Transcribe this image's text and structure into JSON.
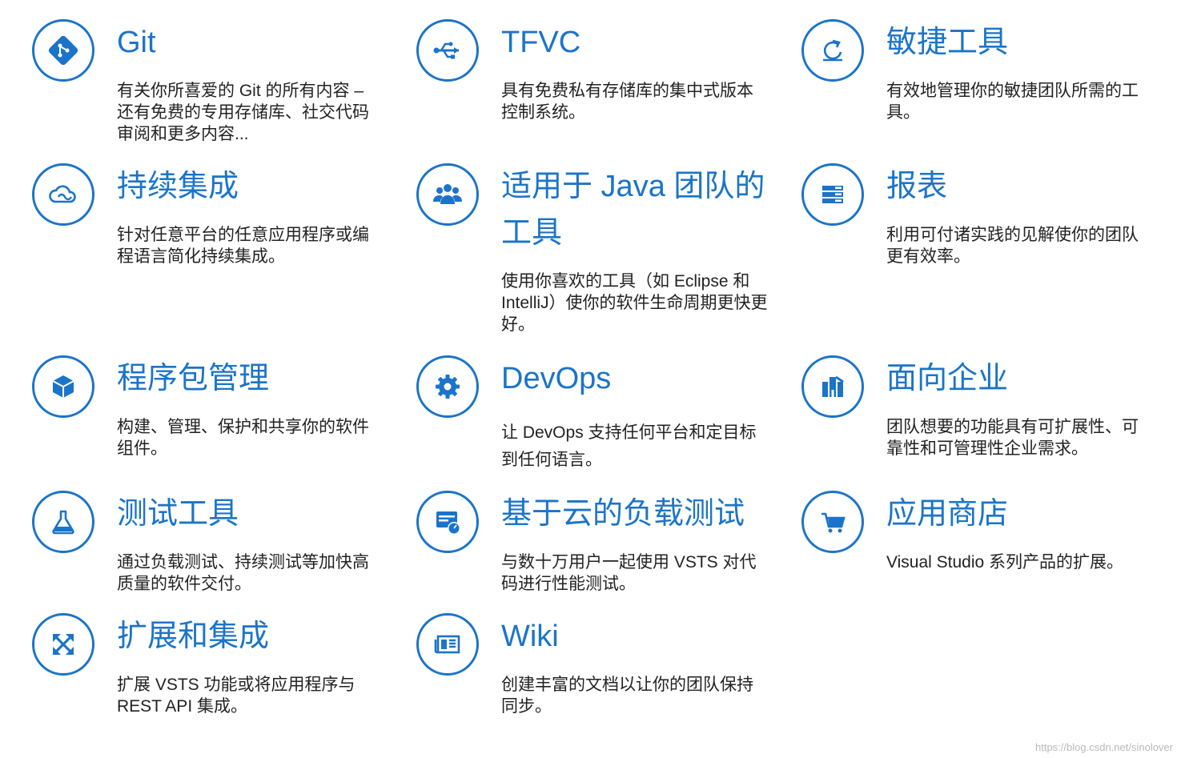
{
  "features": [
    {
      "title": "Git",
      "desc": "有关你所喜爱的 Git 的所有内容 –\n还有免费的专用存储库、社交代码\n审阅和更多内容...",
      "icon": "git-icon"
    },
    {
      "title": "TFVC",
      "desc": "具有免费私有存储库的集中式版本\n控制系统。",
      "icon": "usb-branch-icon"
    },
    {
      "title": "敏捷工具",
      "desc": "有效地管理你的敏捷团队所需的工\n具。",
      "icon": "refresh-cycle-icon"
    },
    {
      "title": "持续集成",
      "desc": "针对任意平台的任意应用程序或编\n程语言简化持续集成。",
      "icon": "cloud-icon"
    },
    {
      "title": "适用于 Java 团队的",
      "title2": "工具",
      "desc": "使用你喜欢的工具（如 Eclipse 和\nIntelliJ）使你的软件生命周期更快更\n好。",
      "icon": "people-group-icon"
    },
    {
      "title": "报表",
      "desc": "利用可付诸实践的见解使你的团队\n更有效率。",
      "icon": "report-bars-icon"
    },
    {
      "title": "程序包管理",
      "desc": "构建、管理、保护和共享你的软件\n组件。",
      "icon": "package-box-icon"
    },
    {
      "title": "DevOps",
      "desc": "让 DevOps 支持任何平台和定目标\n到任何语言。",
      "icon": "gear-icon"
    },
    {
      "title": "面向企业",
      "desc": "团队想要的功能具有可扩展性、可\n靠性和可管理性企业需求。",
      "icon": "enterprise-building-icon"
    },
    {
      "title": "测试工具",
      "desc": "通过负载测试、持续测试等加快高\n质量的软件交付。",
      "icon": "flask-icon"
    },
    {
      "title": "基于云的负载测试",
      "desc": "与数十万用户一起使用 VSTS 对代\n码进行性能测试。",
      "icon": "load-test-gauge-icon"
    },
    {
      "title": "应用商店",
      "desc": "Visual Studio 系列产品的扩展。",
      "icon": "shopping-cart-icon"
    },
    {
      "title": "扩展和集成",
      "desc": "扩展 VSTS 功能或将应用程序与\nREST API 集成。",
      "icon": "expand-arrows-icon"
    },
    {
      "title": "Wiki",
      "desc": "创建丰富的文档以让你的团队保持\n同步。",
      "icon": "newspaper-icon"
    }
  ],
  "watermark": "https://blog.csdn.net/sinolover",
  "colors": {
    "accent": "#1b74c9",
    "text": "#222222"
  }
}
